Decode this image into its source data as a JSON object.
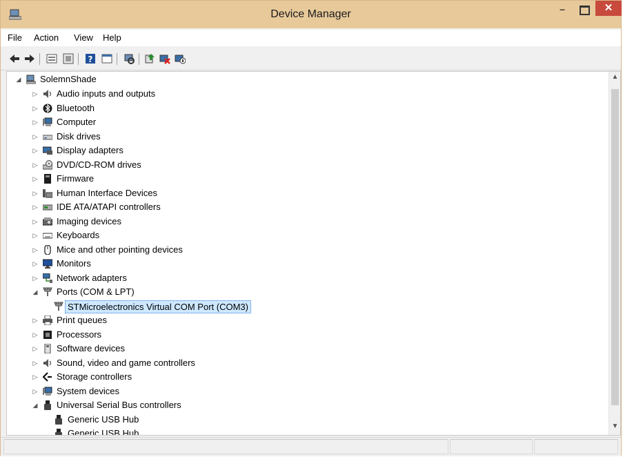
{
  "window": {
    "title": "Device Manager"
  },
  "menu": [
    "File",
    "Action",
    "View",
    "Help"
  ],
  "tree": {
    "root": "SolemnShade",
    "items": [
      {
        "label": "Audio inputs and outputs",
        "icon": "speaker-icon",
        "expanded": false
      },
      {
        "label": "Bluetooth",
        "icon": "bluetooth-icon",
        "expanded": false
      },
      {
        "label": "Computer",
        "icon": "computer-icon",
        "expanded": false
      },
      {
        "label": "Disk drives",
        "icon": "disk-drive-icon",
        "expanded": false
      },
      {
        "label": "Display adapters",
        "icon": "display-adapter-icon",
        "expanded": false
      },
      {
        "label": "DVD/CD-ROM drives",
        "icon": "dvd-drive-icon",
        "expanded": false
      },
      {
        "label": "Firmware",
        "icon": "firmware-icon",
        "expanded": false
      },
      {
        "label": "Human Interface Devices",
        "icon": "hid-icon",
        "expanded": false
      },
      {
        "label": "IDE ATA/ATAPI controllers",
        "icon": "ide-controller-icon",
        "expanded": false
      },
      {
        "label": "Imaging devices",
        "icon": "imaging-device-icon",
        "expanded": false
      },
      {
        "label": "Keyboards",
        "icon": "keyboard-icon",
        "expanded": false
      },
      {
        "label": "Mice and other pointing devices",
        "icon": "mouse-icon",
        "expanded": false
      },
      {
        "label": "Monitors",
        "icon": "monitor-icon",
        "expanded": false
      },
      {
        "label": "Network adapters",
        "icon": "network-adapter-icon",
        "expanded": false
      },
      {
        "label": "Ports (COM & LPT)",
        "icon": "port-icon",
        "expanded": true
      },
      {
        "label": "STMicroelectronics Virtual COM Port (COM3)",
        "icon": "port-icon",
        "child": true,
        "selected": true
      },
      {
        "label": "Print queues",
        "icon": "printer-icon",
        "expanded": false
      },
      {
        "label": "Processors",
        "icon": "processor-icon",
        "expanded": false
      },
      {
        "label": "Software devices",
        "icon": "software-device-icon",
        "expanded": false
      },
      {
        "label": "Sound, video and game controllers",
        "icon": "speaker-icon",
        "expanded": false
      },
      {
        "label": "Storage controllers",
        "icon": "storage-controller-icon",
        "expanded": false
      },
      {
        "label": "System devices",
        "icon": "computer-icon",
        "expanded": false
      },
      {
        "label": "Universal Serial Bus controllers",
        "icon": "usb-icon",
        "expanded": true
      },
      {
        "label": "Generic USB Hub",
        "icon": "usb-icon",
        "child": true
      },
      {
        "label": "Generic USB Hub",
        "icon": "usb-icon",
        "child": true
      }
    ]
  },
  "colors": {
    "titlebar": "#e8c99a",
    "close": "#c74a3c",
    "selection": "#cde8ff"
  }
}
